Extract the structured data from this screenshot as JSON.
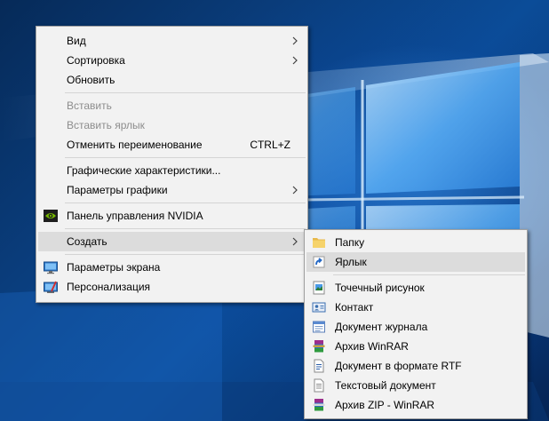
{
  "context_menu": {
    "items": [
      {
        "label": "Вид",
        "has_submenu": true
      },
      {
        "label": "Сортировка",
        "has_submenu": true
      },
      {
        "label": "Обновить"
      },
      {
        "label": "Вставить",
        "disabled": true
      },
      {
        "label": "Вставить ярлык",
        "disabled": true
      },
      {
        "label": "Отменить переименование",
        "shortcut": "CTRL+Z"
      },
      {
        "label": "Графические характеристики..."
      },
      {
        "label": "Параметры графики",
        "has_submenu": true
      },
      {
        "label": "Панель управления NVIDIA",
        "icon": "nvidia-icon"
      },
      {
        "label": "Создать",
        "has_submenu": true,
        "highlighted": true
      },
      {
        "label": "Параметры экрана",
        "icon": "display-settings-icon"
      },
      {
        "label": "Персонализация",
        "icon": "personalization-icon"
      }
    ]
  },
  "create_submenu": {
    "items": [
      {
        "label": "Папку",
        "icon": "folder-icon"
      },
      {
        "label": "Ярлык",
        "icon": "shortcut-icon",
        "highlighted": true
      },
      {
        "label": "Точечный рисунок",
        "icon": "bitmap-image-icon"
      },
      {
        "label": "Контакт",
        "icon": "contact-icon"
      },
      {
        "label": "Документ журнала",
        "icon": "journal-document-icon"
      },
      {
        "label": "Архив WinRAR",
        "icon": "winrar-archive-icon"
      },
      {
        "label": "Документ в формате RTF",
        "icon": "rtf-document-icon"
      },
      {
        "label": "Текстовый документ",
        "icon": "text-document-icon"
      },
      {
        "label": "Архив ZIP - WinRAR",
        "icon": "winrar-zip-icon"
      }
    ]
  },
  "colors": {
    "menu_background": "#f2f2f2",
    "highlight": "#dcdcdc",
    "disabled_text": "#8d8d8d",
    "desktop_blue": "#0b4c98"
  }
}
